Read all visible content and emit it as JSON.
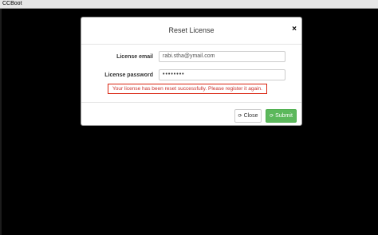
{
  "window": {
    "title": "CCBoot"
  },
  "dialog": {
    "title": "Reset License",
    "close_symbol": "×",
    "email_label": "License email",
    "email_value": "rabi.stha@ymail.com",
    "password_label": "License password",
    "password_value": "••••••••",
    "alert_text": "Your license has been reset successfully. Please register it again.",
    "alert_color": "#d9230f",
    "close_button": "Close",
    "submit_button": "Submit",
    "submit_color": "#5cb85c"
  },
  "icons": {
    "close_button_icon": "refresh-icon",
    "submit_button_icon": "refresh-icon"
  }
}
